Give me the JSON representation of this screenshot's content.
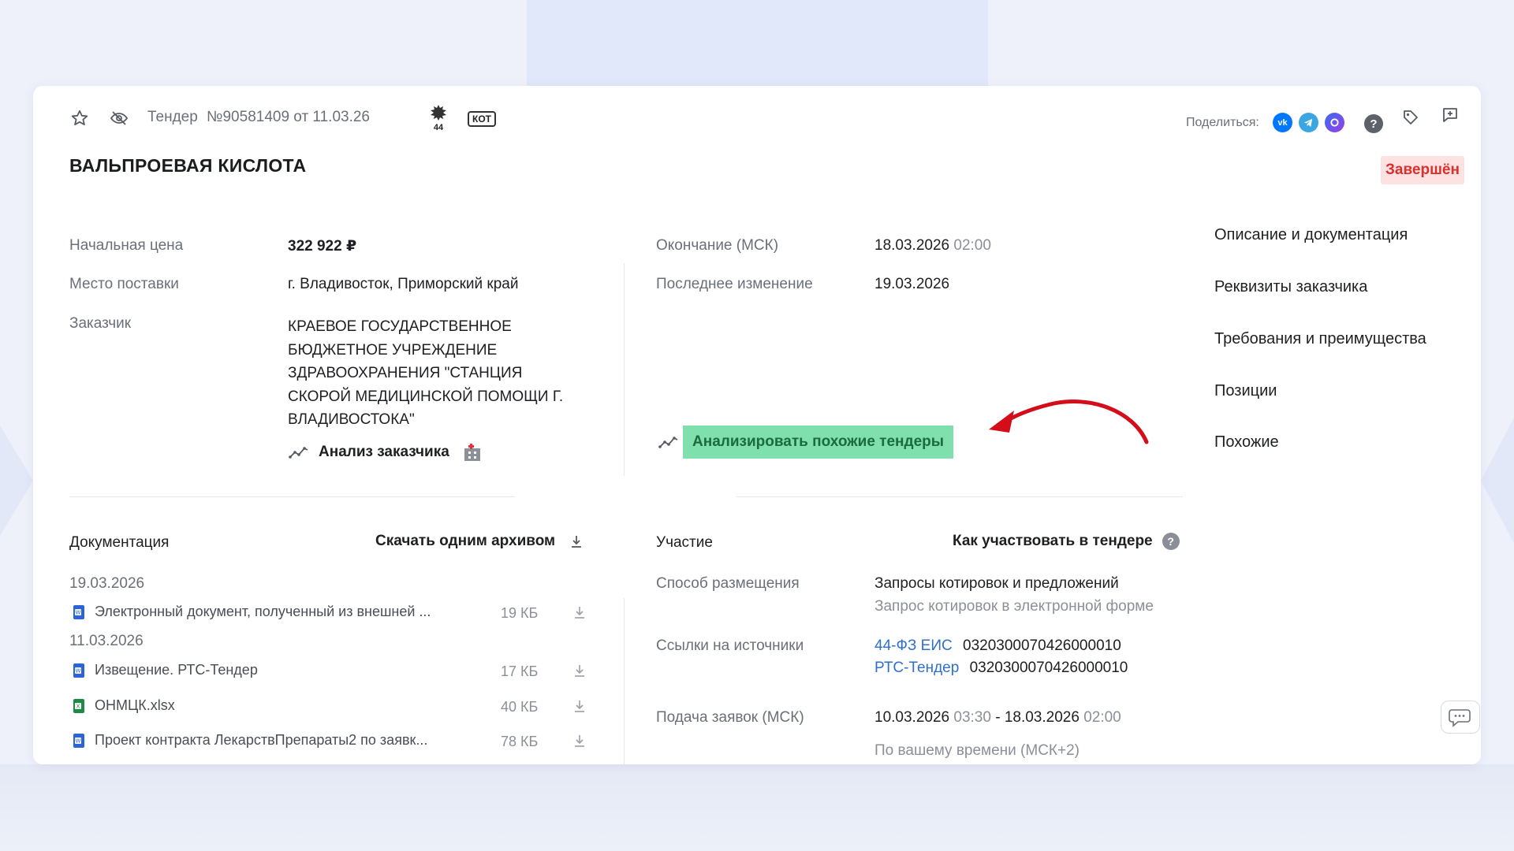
{
  "colors": {
    "accent": "#2f6fcf",
    "status_bg": "#fde2e1",
    "status_text": "#d8302c",
    "highlight": "#7fe0ad",
    "arrow": "#d40d1a"
  },
  "header": {
    "tender_label": "Тендер",
    "tender_number": "№90581409 от 11.03.26",
    "badge_44": "44",
    "badge_kot": "КОТ",
    "share_label": "Поделиться:",
    "share_icons": [
      "vk-icon",
      "telegram-icon",
      "max-icon"
    ]
  },
  "title": "ВАЛЬПРОЕВАЯ КИСЛОТА",
  "status": "Завершён",
  "info_left": {
    "price_label": "Начальная цена",
    "price_value": "322 922 ₽",
    "place_label": "Место поставки",
    "place_value": "г. Владивосток, Приморский край",
    "customer_label": "Заказчик",
    "customer_lines": [
      "КРАЕВОЕ ГОСУДАРСТВЕННОЕ",
      "БЮДЖЕТНОЕ УЧРЕЖДЕНИЕ",
      "ЗДРАВООХРАНЕНИЯ \"СТАНЦИЯ",
      "СКОРОЙ МЕДИЦИНСКОЙ ПОМОЩИ Г.",
      "ВЛАДИВОСТОКА\""
    ],
    "customer_analysis": "Анализ заказчика"
  },
  "info_right": {
    "end_label": "Окончание (МСК)",
    "end_date": "18.03.2026",
    "end_time": "02:00",
    "changed_label": "Последнее изменение",
    "changed_date": "19.03.2026",
    "analyze_similar": "Анализировать похожие тендеры"
  },
  "nav": {
    "items": [
      "Описание и документация",
      "Реквизиты заказчика",
      "Требования и преимущества",
      "Позиции",
      "Похожие"
    ]
  },
  "docs": {
    "heading": "Документация",
    "download_all": "Скачать одним архивом",
    "groups": [
      {
        "date": "19.03.2026",
        "files": [
          {
            "name": "Электронный документ, полученный из внешней ...",
            "size": "19 КБ",
            "type": "word"
          }
        ]
      },
      {
        "date": "11.03.2026",
        "files": [
          {
            "name": "Извещение. РТС-Тендер",
            "size": "17 КБ",
            "type": "word"
          },
          {
            "name": "ОНМЦК.xlsx",
            "size": "40 КБ",
            "type": "excel"
          },
          {
            "name": "Проект контракта ЛекарствПрепараты2 по заявк...",
            "size": "78 КБ",
            "type": "word"
          }
        ]
      }
    ]
  },
  "participation": {
    "heading": "Участие",
    "how_to": "Как участвовать в тендере",
    "method_label": "Способ размещения",
    "method_value": "Запросы котировок и предложений",
    "method_sub": "Запрос котировок в электронной форме",
    "sources_label": "Ссылки на источники",
    "sources": [
      {
        "name": "44-ФЗ ЕИС",
        "id": "0320300070426000010"
      },
      {
        "name": "РТС-Тендер",
        "id": "0320300070426000010"
      }
    ],
    "submit_label": "Подача заявок (МСК)",
    "submit_start_date": "10.03.2026",
    "submit_start_time": "03:30",
    "submit_sep": " - ",
    "submit_end_date": "18.03.2026",
    "submit_end_time": "02:00",
    "local_time": "По вашему времени (МСК+2)"
  }
}
